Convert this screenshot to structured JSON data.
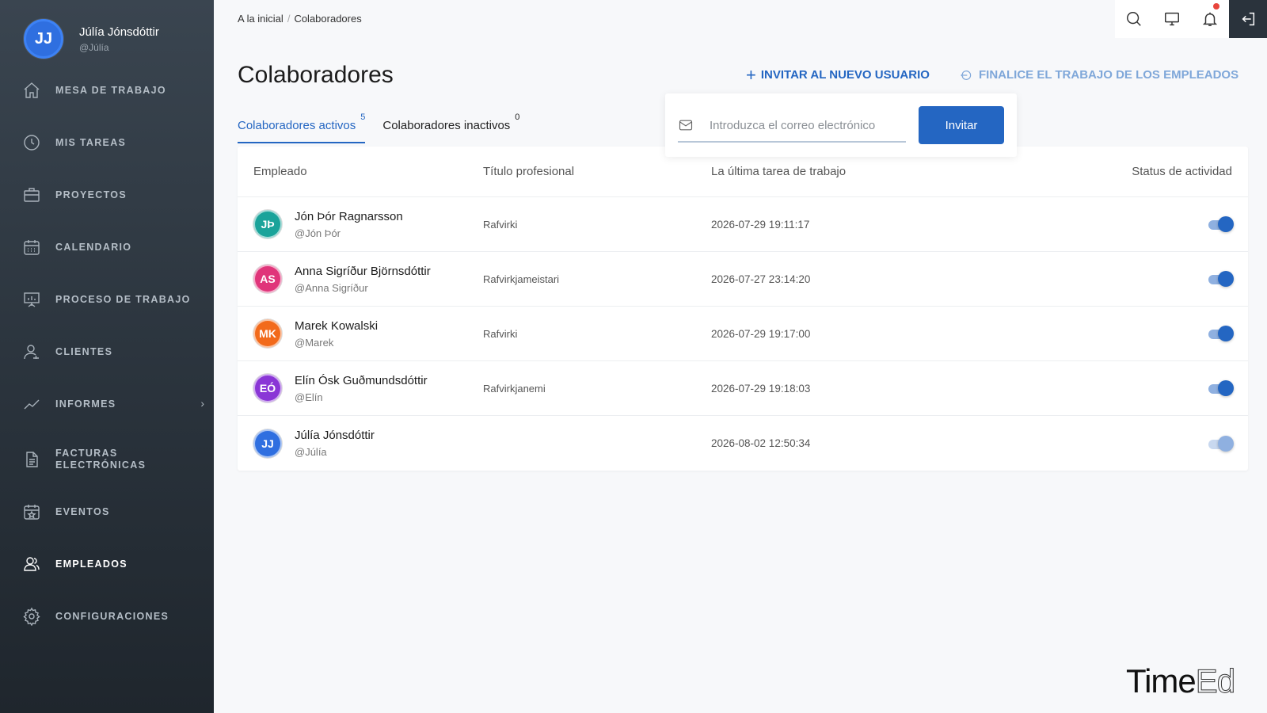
{
  "user": {
    "initials": "JJ",
    "name": "Júlía Jónsdóttir",
    "handle": "@Júlía"
  },
  "sidebar": {
    "items": [
      {
        "label": "MESA DE TRABAJO",
        "icon": "home-icon"
      },
      {
        "label": "MIS TAREAS",
        "icon": "clock-icon"
      },
      {
        "label": "PROYECTOS",
        "icon": "briefcase-icon"
      },
      {
        "label": "CALENDARIO",
        "icon": "calendar-icon"
      },
      {
        "label": "PROCESO DE TRABAJO",
        "icon": "presentation-icon"
      },
      {
        "label": "CLIENTES",
        "icon": "client-icon"
      },
      {
        "label": "INFORMES",
        "icon": "chart-icon"
      },
      {
        "label": "FACTURAS ELECTRÓNICAS",
        "icon": "document-icon"
      },
      {
        "label": "EVENTOS",
        "icon": "event-icon"
      },
      {
        "label": "EMPLEADOS",
        "icon": "users-icon"
      },
      {
        "label": "CONFIGURACIONES",
        "icon": "gear-icon"
      }
    ],
    "active": "EMPLEADOS"
  },
  "breadcrumb": {
    "home": "A la inicial",
    "separator": "/",
    "current": "Colaboradores"
  },
  "page": {
    "title": "Colaboradores",
    "invite_action": "INVITAR AL NUEVO USUARIO",
    "finish_action": "FINALICE EL TRABAJO DE LOS EMPLEADOS"
  },
  "tabs": [
    {
      "label": "Colaboradores activos",
      "count": "5"
    },
    {
      "label": "Colaboradores inactivos",
      "count": "0"
    }
  ],
  "invite": {
    "placeholder": "Introduzca el correo electrónico",
    "button": "Invitar"
  },
  "table": {
    "headers": [
      "Empleado",
      "Título profesional",
      "La última tarea de trabajo",
      "Status de actividad"
    ],
    "rows": [
      {
        "initials": "JÞ",
        "color": "#1aa39a",
        "name": "Jón Þór Ragnarsson",
        "handle": "@Jón Þór",
        "title": "Rafvirki",
        "date": "2026-07-29 19:11:17",
        "active": true
      },
      {
        "initials": "AS",
        "color": "#e0357a",
        "name": "Anna Sigríður Björnsdóttir",
        "handle": "@Anna Sigríður",
        "title": "Rafvirkjameistari",
        "date": "2026-07-27 23:14:20",
        "active": true
      },
      {
        "initials": "MK",
        "color": "#f26a1b",
        "name": "Marek Kowalski",
        "handle": "@Marek",
        "title": "Rafvirki",
        "date": "2026-07-29 19:17:00",
        "active": true
      },
      {
        "initials": "EÓ",
        "color": "#8a36d6",
        "name": "Elín Ósk Guðmundsdóttir",
        "handle": "@Elín",
        "title": "Rafvirkjanemi",
        "date": "2026-07-29 19:18:03",
        "active": true
      },
      {
        "initials": "JJ",
        "color": "#2f6fe0",
        "name": "Júlía Jónsdóttir",
        "handle": "@Júlía",
        "title": "",
        "date": "2026-08-02 12:50:34",
        "active": false
      }
    ]
  },
  "brand": {
    "part1": "Time",
    "part2": "Ed"
  },
  "colors": {
    "accent": "#2466c2",
    "sidebar": "#2a333c"
  }
}
